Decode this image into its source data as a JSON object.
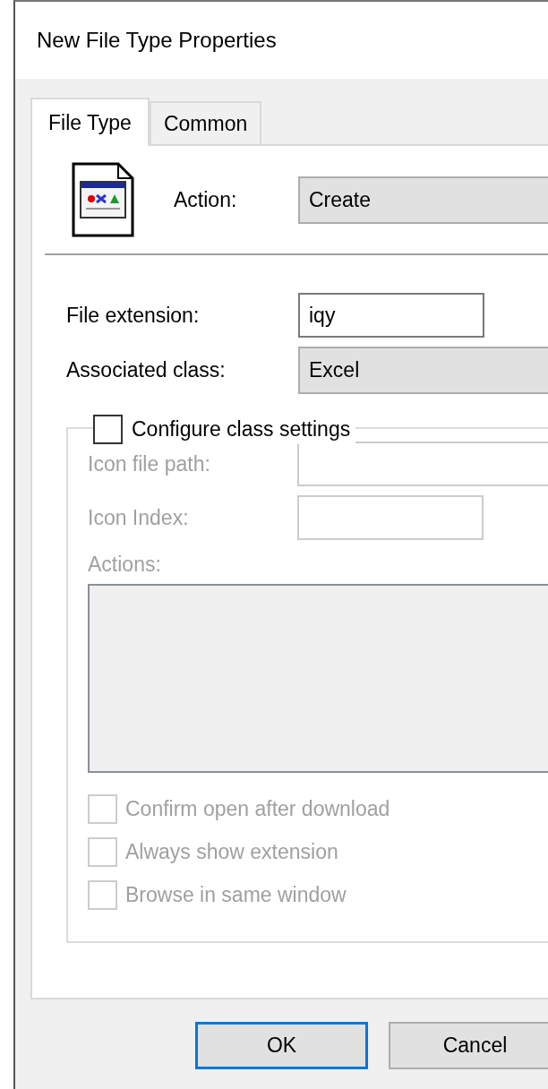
{
  "window": {
    "title": "New File Type Properties"
  },
  "tabs": [
    {
      "label": "File Type",
      "selected": true
    },
    {
      "label": "Common",
      "selected": false
    }
  ],
  "action": {
    "label": "Action:",
    "value": "Create"
  },
  "file_extension": {
    "label": "File extension:",
    "value": "iqy"
  },
  "associated_class": {
    "label": "Associated class:",
    "value": "Excel"
  },
  "configure": {
    "label": "Configure class settings",
    "checked": false,
    "icon_file_path": {
      "label": "Icon file path:"
    },
    "icon_index": {
      "label": "Icon Index:"
    },
    "actions": {
      "label": "Actions:"
    },
    "options": [
      {
        "label": "Confirm open after download",
        "checked": false
      },
      {
        "label": "Always show extension",
        "checked": false
      },
      {
        "label": "Browse in same window",
        "checked": false
      }
    ]
  },
  "buttons": [
    {
      "label": "OK",
      "default": true
    },
    {
      "label": "Cancel",
      "default": false
    }
  ]
}
